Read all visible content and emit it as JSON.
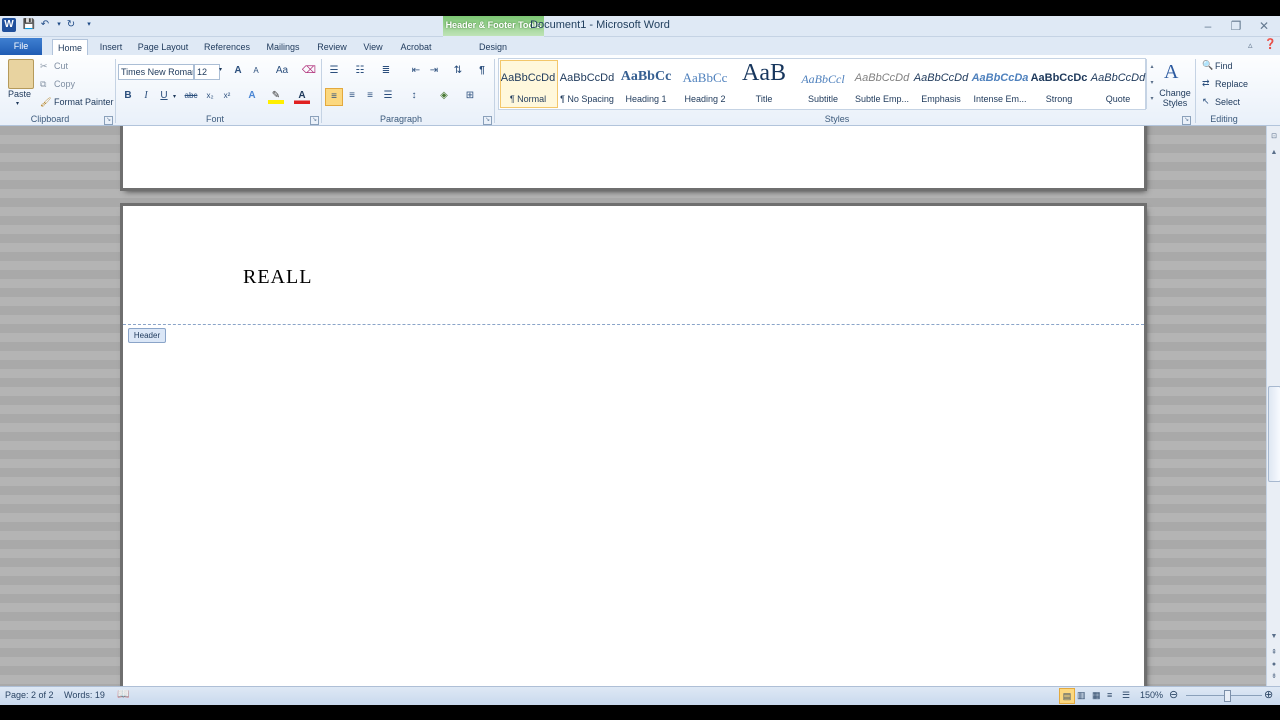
{
  "window": {
    "title": "Document1 - Microsoft Word",
    "contextual_tab_group": "Header & Footer Tools"
  },
  "tabs": [
    "File",
    "Home",
    "Insert",
    "Page Layout",
    "References",
    "Mailings",
    "Review",
    "View",
    "Acrobat",
    "Design"
  ],
  "clipboard": {
    "paste": "Paste",
    "cut": "Cut",
    "copy": "Copy",
    "format_painter": "Format Painter",
    "group_label": "Clipboard"
  },
  "font": {
    "family": "Times New Roman",
    "size": "12",
    "group_label": "Font",
    "bold": "B",
    "italic": "I",
    "underline": "U",
    "strike": "abc",
    "subscript": "x₂",
    "superscript": "x²",
    "grow": "A",
    "shrink": "A",
    "change_case": "Aa"
  },
  "paragraph": {
    "group_label": "Paragraph"
  },
  "styles": {
    "group_label": "Styles",
    "items": [
      {
        "sample": "AaBbCcDd",
        "name": "¶ Normal"
      },
      {
        "sample": "AaBbCcDd",
        "name": "¶ No Spacing"
      },
      {
        "sample": "AaBbCc",
        "name": "Heading 1"
      },
      {
        "sample": "AaBbCc",
        "name": "Heading 2"
      },
      {
        "sample": "AaB",
        "name": "Title"
      },
      {
        "sample": "AaBbCcl",
        "name": "Subtitle"
      },
      {
        "sample": "AaBbCcDd",
        "name": "Subtle Emp..."
      },
      {
        "sample": "AaBbCcDd",
        "name": "Emphasis"
      },
      {
        "sample": "AaBbCcDa",
        "name": "Intense Em..."
      },
      {
        "sample": "AaBbCcDc",
        "name": "Strong"
      },
      {
        "sample": "AaBbCcDd",
        "name": "Quote"
      }
    ],
    "change_styles": "Change Styles"
  },
  "editing": {
    "group_label": "Editing",
    "find": "Find",
    "replace": "Replace",
    "select": "Select"
  },
  "document": {
    "header_text": "REALL",
    "header_tag": "Header"
  },
  "status": {
    "page": "Page: 2 of 2",
    "words": "Words: 19",
    "zoom": "150%"
  },
  "colors": {
    "accent": "#1f5cb4",
    "contextual_green": "#7cc573"
  }
}
